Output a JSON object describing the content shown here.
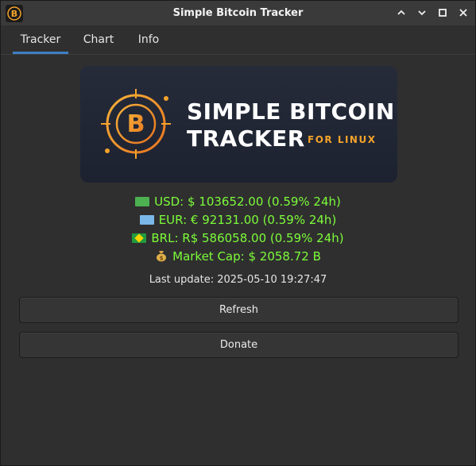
{
  "window": {
    "title": "Simple Bitcoin Tracker",
    "controls": [
      "chevron-up-icon",
      "minimize-icon",
      "maximize-icon",
      "close-icon"
    ]
  },
  "tabs": [
    {
      "label": "Tracker",
      "active": true
    },
    {
      "label": "Chart",
      "active": false
    },
    {
      "label": "Info",
      "active": false
    }
  ],
  "banner": {
    "line1": "SIMPLE BITCOIN",
    "line2": "TRACKER",
    "sub": "FOR LINUX"
  },
  "prices": {
    "usd": "USD: $ 103652.00 (0.59% 24h)",
    "eur": "EUR: € 92131.00 (0.59% 24h)",
    "brl": "BRL: R$ 586058.00 (0.59% 24h)",
    "market_cap": "Market Cap: $ 2058.72 B"
  },
  "last_update": "Last update: 2025-05-10 19:27:47",
  "buttons": {
    "refresh": "Refresh",
    "donate": "Donate"
  },
  "colors": {
    "accent": "#3d7fc4",
    "price_text": "#7cfc3a",
    "bitcoin_orange": "#f4a32a",
    "background": "#2f2f2f"
  }
}
